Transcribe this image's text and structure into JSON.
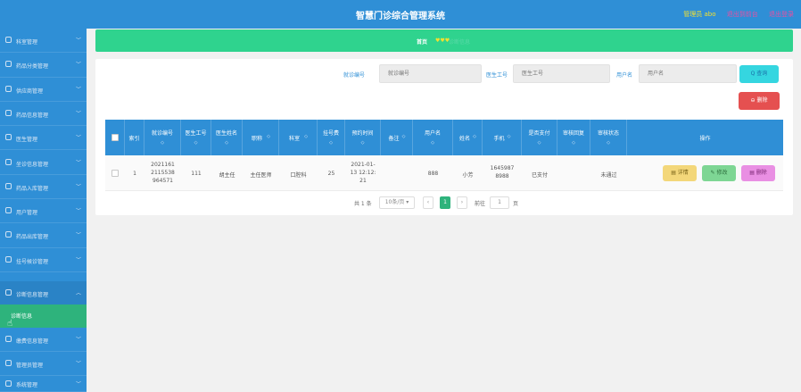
{
  "header": {
    "title": "智慧门诊综合管理系统",
    "admin_label": "管理员 abo",
    "front_link": "退出到前台",
    "logout_link": "退出登录"
  },
  "sidebar": {
    "items": [
      {
        "label": "科室管理",
        "icon": "grid-icon"
      },
      {
        "label": "药品分类管理",
        "icon": "list-icon"
      },
      {
        "label": "供应商管理",
        "icon": "truck-icon"
      },
      {
        "label": "药品信息管理",
        "icon": "pill-icon"
      },
      {
        "label": "医生管理",
        "icon": "doctor-icon"
      },
      {
        "label": "坐诊信息管理",
        "icon": "chart-icon"
      },
      {
        "label": "药品入库管理",
        "icon": "inbox-icon"
      },
      {
        "label": "用户管理",
        "icon": "user-icon"
      },
      {
        "label": "药品出库管理",
        "icon": "outbox-icon"
      },
      {
        "label": "挂号候诊管理",
        "icon": "ticket-icon"
      },
      {
        "label": "诊断信息管理",
        "icon": "file-icon"
      },
      {
        "label": "缴费信息管理",
        "icon": "wallet-icon"
      },
      {
        "label": "管理员管理",
        "icon": "admin-icon"
      },
      {
        "label": "系统管理",
        "icon": "gear-icon"
      }
    ],
    "submenu_label": "诊断信息"
  },
  "breadcrumb": {
    "home": "首页",
    "dots": "♥♥♥"
  },
  "search": {
    "f1_label": "就诊编号",
    "f1_placeholder": "就诊编号",
    "f2_label": "医生工号",
    "f2_placeholder": "医生工号",
    "f3_label": "用户名",
    "f3_placeholder": "用户名",
    "search_btn": "Q 查询",
    "delete_btn": "⊖ 删除"
  },
  "table": {
    "headers": [
      {
        "label": "索引",
        "sortable": false
      },
      {
        "label": "就诊编号",
        "sortable": true
      },
      {
        "label": "医生工号",
        "sortable": true
      },
      {
        "label": "医生姓名",
        "sortable": true
      },
      {
        "label": "职称",
        "sortable": true
      },
      {
        "label": "科室",
        "sortable": true
      },
      {
        "label": "挂号费",
        "sortable": true
      },
      {
        "label": "预约时间",
        "sortable": true
      },
      {
        "label": "备注",
        "sortable": true
      },
      {
        "label": "用户名",
        "sortable": true
      },
      {
        "label": "姓名",
        "sortable": true
      },
      {
        "label": "手机",
        "sortable": true
      },
      {
        "label": "是否支付",
        "sortable": true
      },
      {
        "label": "审核回复",
        "sortable": true
      },
      {
        "label": "审核状态",
        "sortable": true
      },
      {
        "label": "操作",
        "sortable": false
      }
    ],
    "sort_glyph": "◇",
    "rows": [
      {
        "index": "1",
        "visit_no_1": "2021161",
        "visit_no_2": "2115538",
        "visit_no_3": "964571",
        "doctor_no": "111",
        "doctor_name": "胡主任",
        "title": "主任医师",
        "dept": "口腔科",
        "fee": "25",
        "time_1": "2021-01-",
        "time_2": "13 12:12:",
        "time_3": "21",
        "remark": "",
        "username": "888",
        "name": "小芳",
        "phone_1": "1645987",
        "phone_2": "8988",
        "paid": "已支付",
        "reply": "",
        "status": "未通过",
        "detail_btn": "▤ 详情",
        "edit_btn": "✎ 修改",
        "delete_btn": "▤ 删除"
      }
    ]
  },
  "pagination": {
    "total": "共 1 条",
    "page_size": "10条/页 ▾",
    "prev": "‹",
    "current": "1",
    "next": "›",
    "goto_label": "前往",
    "goto_value": "1",
    "page_unit": "页"
  },
  "colors": {
    "primary": "#2f8fd6",
    "banner": "#2fd38e",
    "search_btn": "#35d6e0",
    "danger": "#e55050",
    "detail": "#f3d77a",
    "edit": "#7ed694",
    "delete_row": "#e98fe3"
  }
}
